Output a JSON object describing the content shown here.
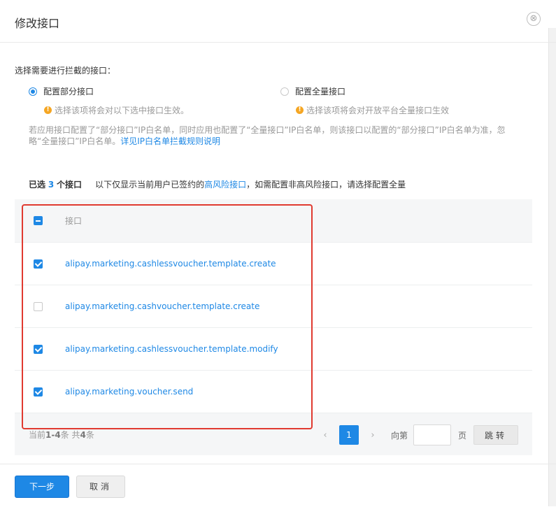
{
  "header": {
    "title": "修改接口",
    "close_icon": "⊗"
  },
  "scope": {
    "label": "选择需要进行拦截的接口：",
    "options": [
      {
        "label": "配置部分接口",
        "hint": "选择该项将会对以下选中接口生效。",
        "selected": true
      },
      {
        "label": "配置全量接口",
        "hint": "选择该项将会对开放平台全量接口生效",
        "selected": false
      }
    ],
    "note_text": "若应用接口配置了“部分接口”IP白名单，同时应用也配置了“全量接口”IP白名单，则该接口以配置的“部分接口”IP白名单为准，忽略“全量接口”IP白名单。",
    "note_link": "详见IP白名单拦截规则说明"
  },
  "summary": {
    "prefix": "已选",
    "count": "3",
    "suffix": "个接口",
    "desc_before": "以下仅显示当前用户已签约的",
    "desc_link": "高风险接口",
    "desc_after": "，如需配置非高风险接口，请选择配置全量"
  },
  "table": {
    "header_label": "接口",
    "rows": [
      {
        "api": "alipay.marketing.cashlessvoucher.template.create",
        "checked": true
      },
      {
        "api": "alipay.marketing.cashvoucher.template.create",
        "checked": false
      },
      {
        "api": "alipay.marketing.cashlessvoucher.template.modify",
        "checked": true
      },
      {
        "api": "alipay.marketing.voucher.send",
        "checked": true
      }
    ]
  },
  "pagination": {
    "count_prefix": "当前",
    "count_range": "1-4",
    "count_mid": "条 共",
    "count_total": "4",
    "count_suffix": "条",
    "prev": "‹",
    "page": "1",
    "next": "›",
    "jump_label": "向第",
    "page_label": "页",
    "jump_button": "跳转"
  },
  "actions": {
    "next": "下一步",
    "cancel": "取消"
  },
  "colors": {
    "accent": "#1e88e5",
    "highlight": "#e03a30",
    "warning": "#f5a623"
  }
}
